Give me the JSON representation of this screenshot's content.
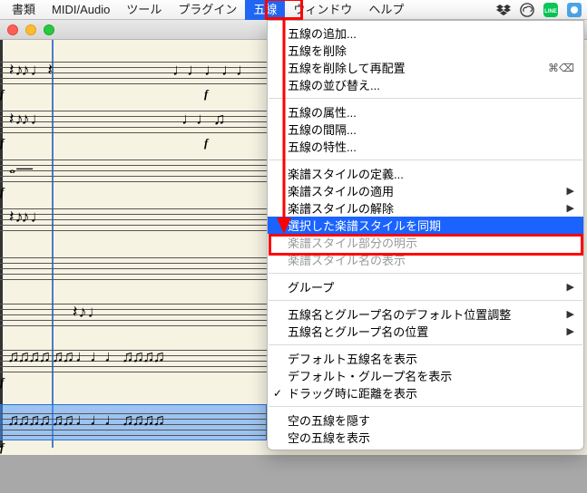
{
  "menubar": {
    "items": [
      "書類",
      "MIDI/Audio",
      "ツール",
      "プラグイン",
      "五線",
      "ウィンドウ",
      "ヘルプ"
    ],
    "selected_index": 4
  },
  "status_icons": [
    "dropbox",
    "creative-cloud",
    "line",
    "app"
  ],
  "window": {
    "file_ext": "usx"
  },
  "dropdown": {
    "groups": [
      [
        {
          "label": "五線の追加...",
          "enabled": true
        },
        {
          "label": "五線を削除",
          "enabled": true
        },
        {
          "label": "五線を削除して再配置",
          "enabled": true,
          "shortcut_icon": "cmd-del"
        },
        {
          "label": "五線の並び替え...",
          "enabled": true
        }
      ],
      [
        {
          "label": "五線の属性...",
          "enabled": true
        },
        {
          "label": "五線の間隔...",
          "enabled": true
        },
        {
          "label": "五線の特性...",
          "enabled": true
        }
      ],
      [
        {
          "label": "楽譜スタイルの定義...",
          "enabled": true
        },
        {
          "label": "楽譜スタイルの適用",
          "enabled": true,
          "submenu": true
        },
        {
          "label": "楽譜スタイルの解除",
          "enabled": true,
          "submenu": true
        },
        {
          "label": "選択した楽譜スタイルを同期",
          "enabled": true,
          "highlighted": true
        },
        {
          "label": "楽譜スタイル部分の明示",
          "enabled": false
        },
        {
          "label": "楽譜スタイル名の表示",
          "enabled": false
        }
      ],
      [
        {
          "label": "グループ",
          "enabled": true,
          "submenu": true
        }
      ],
      [
        {
          "label": "五線名とグループ名のデフォルト位置調整",
          "enabled": true,
          "submenu": true
        },
        {
          "label": "五線名とグループ名の位置",
          "enabled": true,
          "submenu": true
        }
      ],
      [
        {
          "label": "デフォルト五線名を表示",
          "enabled": true
        },
        {
          "label": "デフォルト・グループ名を表示",
          "enabled": true
        },
        {
          "label": "ドラッグ時に距離を表示",
          "enabled": true,
          "checked": true
        }
      ],
      [
        {
          "label": "空の五線を隠す",
          "enabled": true
        },
        {
          "label": "空の五線を表示",
          "enabled": true
        }
      ]
    ]
  },
  "score": {
    "dynamic_marking": "f"
  }
}
